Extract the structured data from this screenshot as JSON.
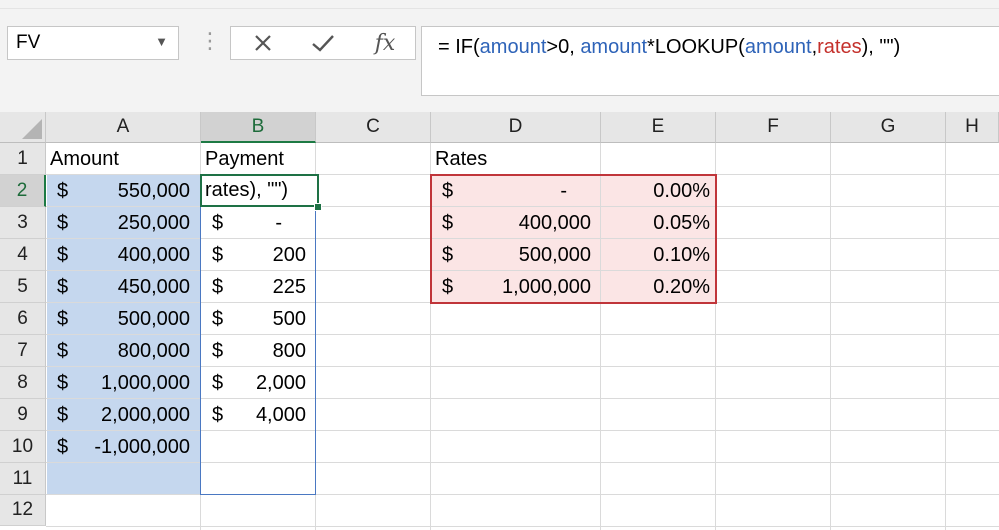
{
  "namebox": {
    "value": "FV"
  },
  "formula_bar": {
    "parts": [
      {
        "t": "= IF(",
        "c": "plain"
      },
      {
        "t": "amount",
        "c": "blue"
      },
      {
        "t": ">0, ",
        "c": "plain"
      },
      {
        "t": "amount",
        "c": "blue"
      },
      {
        "t": "*LOOKUP(",
        "c": "plain"
      },
      {
        "t": "amount",
        "c": "blue"
      },
      {
        "t": ",",
        "c": "plain"
      },
      {
        "t": "rates",
        "c": "red"
      },
      {
        "t": "), \"\")",
        "c": "plain"
      }
    ]
  },
  "icons": {
    "cancel": "close-icon",
    "enter": "checkmark-icon",
    "function": "fx-icon",
    "dropdown": "chevron-down-icon"
  },
  "columns": [
    "A",
    "B",
    "C",
    "D",
    "E",
    "F",
    "G",
    "H"
  ],
  "rows": [
    "1",
    "2",
    "3",
    "4",
    "5",
    "6",
    "7",
    "8",
    "9",
    "10",
    "11",
    "12"
  ],
  "headers": {
    "amount": "Amount",
    "payment": "Payment",
    "rates": "Rates"
  },
  "editing_cell": {
    "ref": "B2",
    "text": "rates), \"\")"
  },
  "currency_symbol": "$",
  "amounts": [
    "550,000",
    "250,000",
    "400,000",
    "450,000",
    "500,000",
    "800,000",
    "1,000,000",
    "2,000,000",
    "-1,000,000"
  ],
  "payments": [
    "-",
    "200",
    "225",
    "500",
    "800",
    "2,000",
    "4,000"
  ],
  "rates_table": [
    {
      "threshold": "-",
      "rate": "0.00%"
    },
    {
      "threshold": "400,000",
      "rate": "0.05%"
    },
    {
      "threshold": "500,000",
      "rate": "0.10%"
    },
    {
      "threshold": "1,000,000",
      "rate": "0.20%"
    }
  ],
  "colors": {
    "selection_fill": "#c5d7ee",
    "rates_fill": "#fbe5e5",
    "rates_border": "#c0353a",
    "active_cell_border": "#1e7145",
    "name_blue": "#2e63b8",
    "name_red": "#c4302b"
  }
}
